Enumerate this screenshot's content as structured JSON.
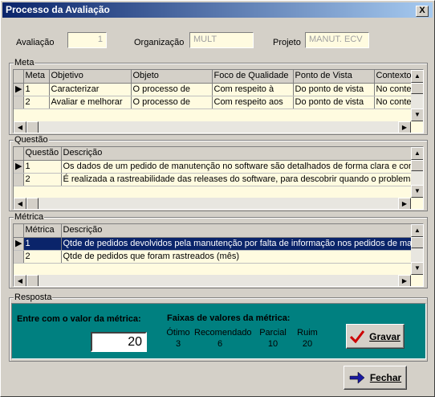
{
  "window": {
    "title": "Processo da Avaliação",
    "close": "X"
  },
  "header": {
    "avaliacao_label": "Avaliação",
    "avaliacao_value": "1",
    "organizacao_label": "Organização",
    "organizacao_value": "MULT",
    "projeto_label": "Projeto",
    "projeto_value": "MANUT. ECV"
  },
  "meta": {
    "title": "Meta",
    "columns": [
      "Meta",
      "Objetivo",
      "Objeto",
      "Foco de Qualidade",
      "Ponto de Vista",
      "Contexto"
    ],
    "rows": [
      [
        "1",
        "Caracterizar",
        "O processo de",
        "Com respeito à",
        "Do ponto de vista",
        "No conte"
      ],
      [
        "2",
        "Avaliar e melhorar",
        "O processo de",
        "Com respeito aos",
        "Do ponto de vista",
        "No conte"
      ]
    ]
  },
  "questao": {
    "title": "Questão",
    "columns": [
      "Questão",
      "Descrição"
    ],
    "rows": [
      [
        "1",
        "Os dados de um pedido de manutenção no software são detalhados de forma clara e concis"
      ],
      [
        "2",
        "É realizada a rastreabilidade das releases do software, para descobrir quando o problema foi"
      ]
    ]
  },
  "metrica": {
    "title": "Métrica",
    "columns": [
      "Métrica",
      "Descrição"
    ],
    "rows": [
      [
        "1",
        "Qtde de pedidos devolvidos pela manutenção por falta de informação nos pedidos de manut"
      ],
      [
        "2",
        "Qtde de pedidos que foram rastreados (mês)"
      ]
    ],
    "selected_row": 0
  },
  "resposta": {
    "title": "Resposta",
    "prompt": "Entre com o valor da métrica:",
    "value": "20",
    "faixas_title": "Faixas de valores da métrica:",
    "faixas": [
      {
        "label": "Ótimo",
        "value": "3"
      },
      {
        "label": "Recomendado",
        "value": "6"
      },
      {
        "label": "Parcial",
        "value": "10"
      },
      {
        "label": "Ruim",
        "value": "20"
      }
    ],
    "gravar_label": "Gravar"
  },
  "fechar_label": "Fechar",
  "colors": {
    "title_start": "#0a246a",
    "title_end": "#a6caf0",
    "grid_bg": "#fffbe0",
    "resposta_bg": "#008080",
    "selection": "#0a246a",
    "gravar_check": "#cc0000",
    "fechar_arrow": "#1a1aa0"
  }
}
